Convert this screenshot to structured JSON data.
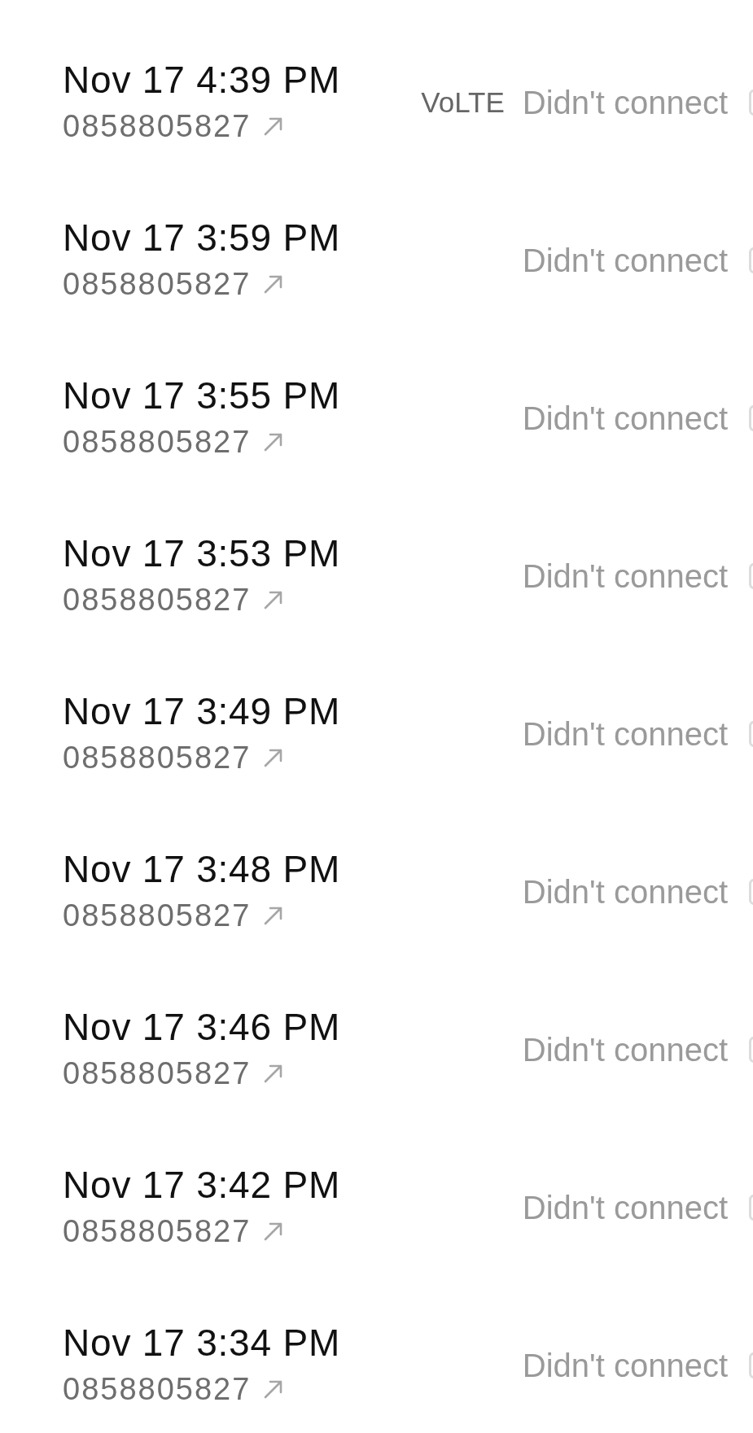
{
  "calls": [
    {
      "time": "Nov 17 4:39 PM",
      "number": "0858805827",
      "outgoing": true,
      "network": "VoLTE",
      "status": "Didn't connect"
    },
    {
      "time": "Nov 17 3:59 PM",
      "number": "0858805827",
      "outgoing": true,
      "status": "Didn't connect"
    },
    {
      "time": "Nov 17 3:55 PM",
      "number": "0858805827",
      "outgoing": true,
      "status": "Didn't connect"
    },
    {
      "time": "Nov 17 3:53 PM",
      "number": "0858805827",
      "outgoing": true,
      "status": "Didn't connect"
    },
    {
      "time": "Nov 17 3:49 PM",
      "number": "0858805827",
      "outgoing": true,
      "status": "Didn't connect"
    },
    {
      "time": "Nov 17 3:48 PM",
      "number": "0858805827",
      "outgoing": true,
      "status": "Didn't connect"
    },
    {
      "time": "Nov 17 3:46 PM",
      "number": "0858805827",
      "outgoing": true,
      "status": "Didn't connect"
    },
    {
      "time": "Nov 17 3:42 PM",
      "number": "0858805827",
      "outgoing": true,
      "status": "Didn't connect"
    },
    {
      "time": "Nov 17 3:34 PM",
      "number": "0858805827",
      "outgoing": true,
      "status": "Didn't connect"
    }
  ]
}
